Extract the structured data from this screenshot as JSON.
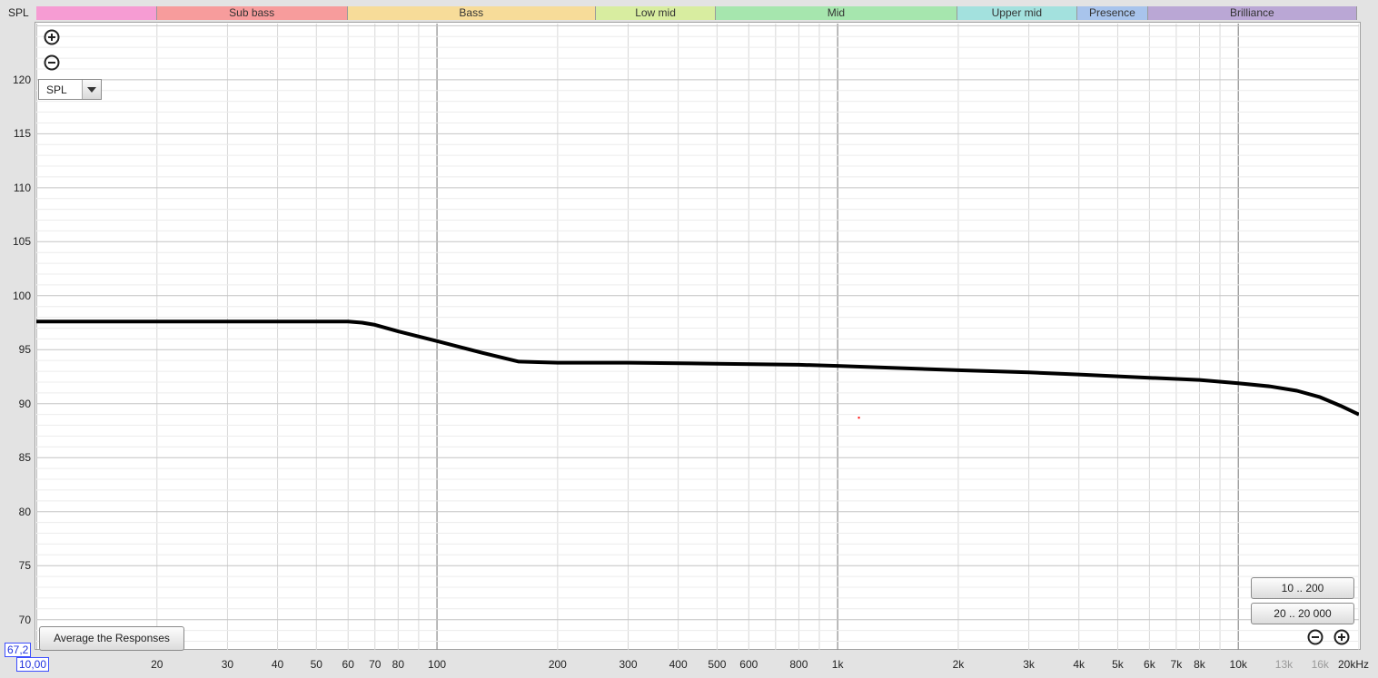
{
  "header": {
    "axis_title": "SPL"
  },
  "bands": [
    {
      "label": "",
      "from": 10,
      "to": 20,
      "color": "#f69cd3"
    },
    {
      "label": "Sub bass",
      "from": 20,
      "to": 60,
      "color": "#f79c9c"
    },
    {
      "label": "Bass",
      "from": 60,
      "to": 250,
      "color": "#f7dc99"
    },
    {
      "label": "Low mid",
      "from": 250,
      "to": 500,
      "color": "#d8eda0"
    },
    {
      "label": "Mid",
      "from": 500,
      "to": 2000,
      "color": "#a6e6ae"
    },
    {
      "label": "Upper mid",
      "from": 2000,
      "to": 4000,
      "color": "#a3e1de"
    },
    {
      "label": "Presence",
      "from": 4000,
      "to": 6000,
      "color": "#a8c4ec"
    },
    {
      "label": "Brilliance",
      "from": 6000,
      "to": 20000,
      "color": "#baa7d5"
    }
  ],
  "controls": {
    "zoom_in_label": "zoom-in-icon",
    "zoom_out_label": "zoom-out-icon",
    "select_value": "SPL",
    "average_button": "Average the Responses",
    "zoom_preset_1": "10 .. 200",
    "zoom_preset_2": "20 .. 20 000"
  },
  "cursor": {
    "y_readout": "67,2",
    "x_readout": "10,00"
  },
  "chart_data": {
    "type": "line",
    "x_scale": "log",
    "xlim": [
      10,
      20000
    ],
    "ylim": [
      67.2,
      125.2
    ],
    "grid": true,
    "y_ticks": [
      120,
      115,
      110,
      105,
      100,
      95,
      90,
      85,
      80,
      75,
      70
    ],
    "x_tick_labels": [
      {
        "value": 20,
        "label": "20"
      },
      {
        "value": 30,
        "label": "30"
      },
      {
        "value": 40,
        "label": "40"
      },
      {
        "value": 50,
        "label": "50"
      },
      {
        "value": 60,
        "label": "60"
      },
      {
        "value": 70,
        "label": "70"
      },
      {
        "value": 80,
        "label": "80"
      },
      {
        "value": 100,
        "label": "100"
      },
      {
        "value": 200,
        "label": "200"
      },
      {
        "value": 300,
        "label": "300"
      },
      {
        "value": 400,
        "label": "400"
      },
      {
        "value": 500,
        "label": "500"
      },
      {
        "value": 600,
        "label": "600"
      },
      {
        "value": 800,
        "label": "800"
      },
      {
        "value": 1000,
        "label": "1k"
      },
      {
        "value": 2000,
        "label": "2k"
      },
      {
        "value": 3000,
        "label": "3k"
      },
      {
        "value": 4000,
        "label": "4k"
      },
      {
        "value": 5000,
        "label": "5k"
      },
      {
        "value": 6000,
        "label": "6k"
      },
      {
        "value": 7000,
        "label": "7k"
      },
      {
        "value": 8000,
        "label": "8k"
      },
      {
        "value": 10000,
        "label": "10k"
      },
      {
        "value": 13000,
        "label": "13k",
        "dim": true
      },
      {
        "value": 16000,
        "label": "16k",
        "dim": true
      },
      {
        "value": 20000,
        "label": "20kHz"
      }
    ],
    "series": [
      {
        "color": "#000000",
        "x": [
          10,
          20,
          40,
          60,
          65,
          70,
          80,
          100,
          130,
          160,
          200,
          300,
          500,
          800,
          1000,
          2000,
          3000,
          4000,
          6000,
          8000,
          10000,
          12000,
          14000,
          16000,
          18000,
          20000
        ],
        "y": [
          97.6,
          97.6,
          97.6,
          97.6,
          97.5,
          97.3,
          96.7,
          95.8,
          94.7,
          93.9,
          93.8,
          93.8,
          93.7,
          93.6,
          93.5,
          93.1,
          92.9,
          92.7,
          92.4,
          92.2,
          91.9,
          91.6,
          91.2,
          90.6,
          89.8,
          89.0
        ]
      }
    ],
    "markers": [
      {
        "x": 1130,
        "y": 88.7,
        "color": "#ff0000"
      }
    ]
  }
}
